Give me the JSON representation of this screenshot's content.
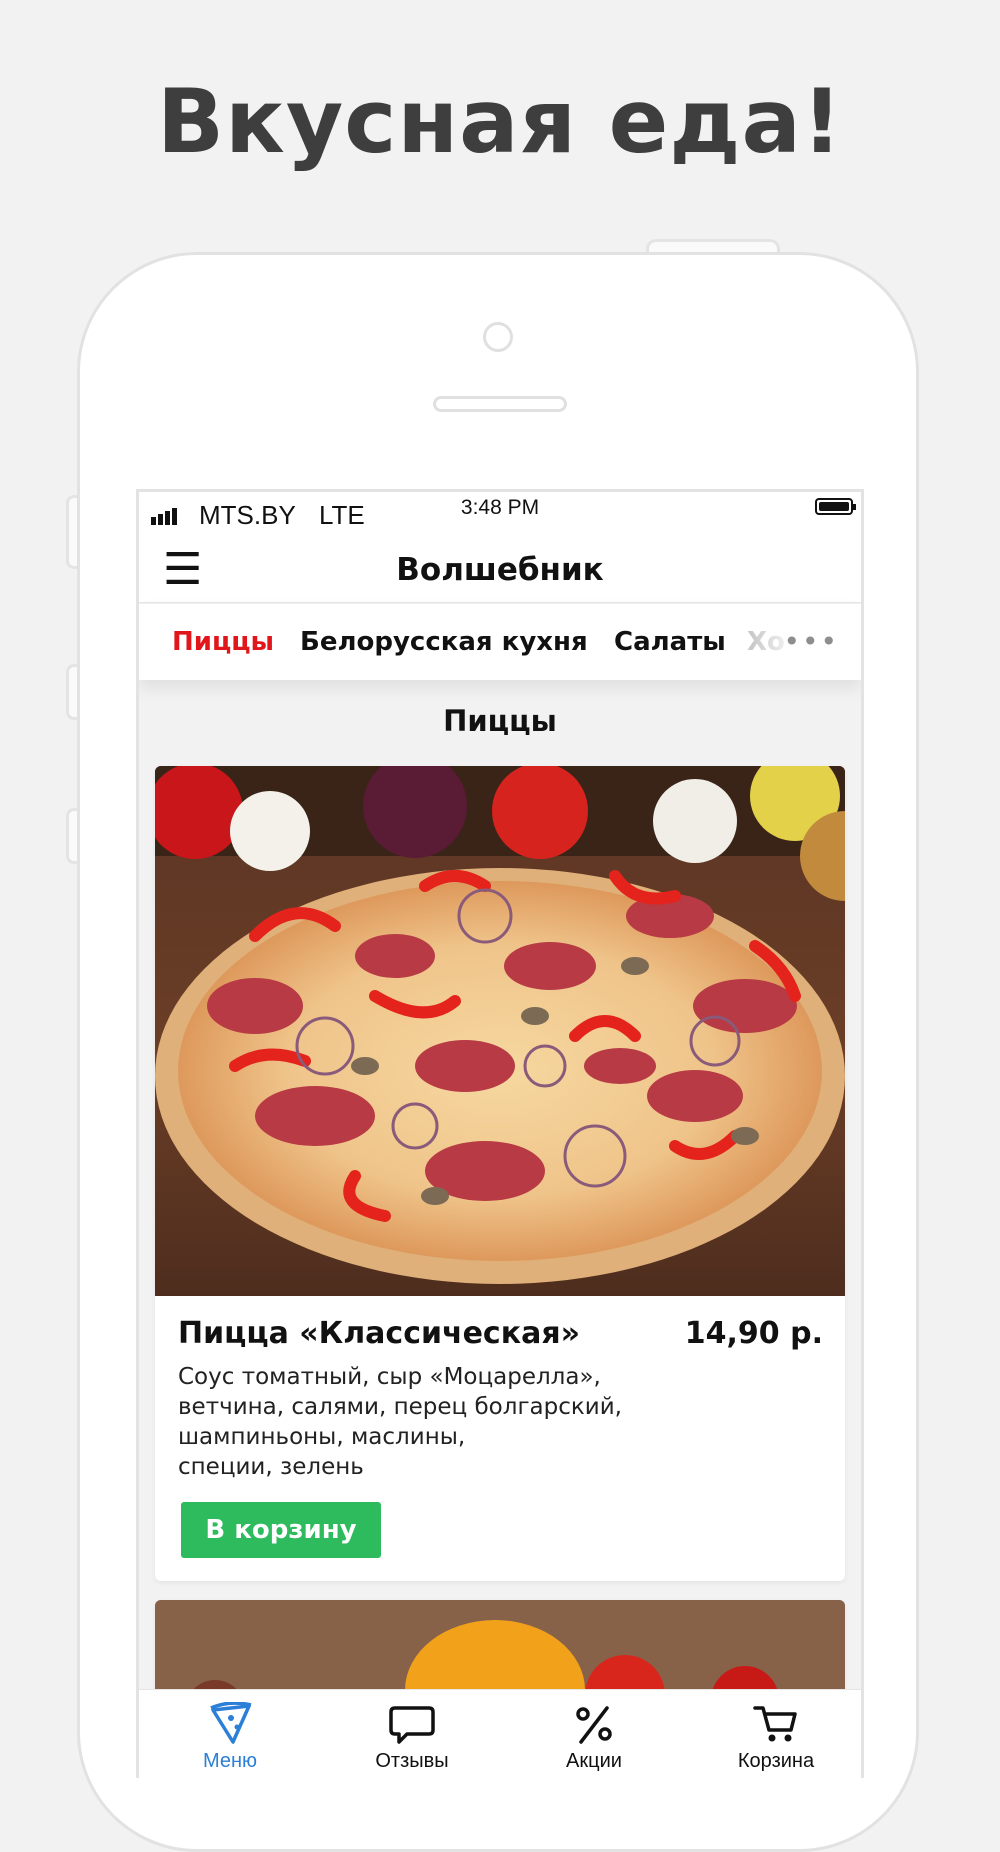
{
  "headline": "Вкусная еда!",
  "status_bar": {
    "carrier": "MTS.BY",
    "network": "LTE",
    "time": "3:48 PM"
  },
  "nav": {
    "title": "Волшебник",
    "menu_icon": "hamburger-icon"
  },
  "tabs": [
    {
      "label": "Пиццы",
      "active": true
    },
    {
      "label": "Белорусская кухня",
      "active": false
    },
    {
      "label": "Салаты",
      "active": false
    },
    {
      "label": "Хо",
      "active": false
    }
  ],
  "more_icon": "more-horizontal-icon",
  "section_title": "Пиццы",
  "items": [
    {
      "name": "Пицца «Классическая»",
      "price": "14,90 р.",
      "description": "Соус томатный, сыр «Моцарелла»,\nветчина, салями, перец болгарский,\nшампиньоны, маслины,\nспеции, зелень",
      "button": "В корзину"
    }
  ],
  "bottom_nav": [
    {
      "label": "Меню",
      "icon": "pizza-slice-icon",
      "active": true
    },
    {
      "label": "Отзывы",
      "icon": "chat-bubble-icon",
      "active": false
    },
    {
      "label": "Акции",
      "icon": "percent-icon",
      "active": false
    },
    {
      "label": "Корзина",
      "icon": "cart-icon",
      "active": false
    }
  ],
  "colors": {
    "accent_red": "#e0161b",
    "button_green": "#2dbb5d",
    "active_blue": "#2b7fd6"
  }
}
